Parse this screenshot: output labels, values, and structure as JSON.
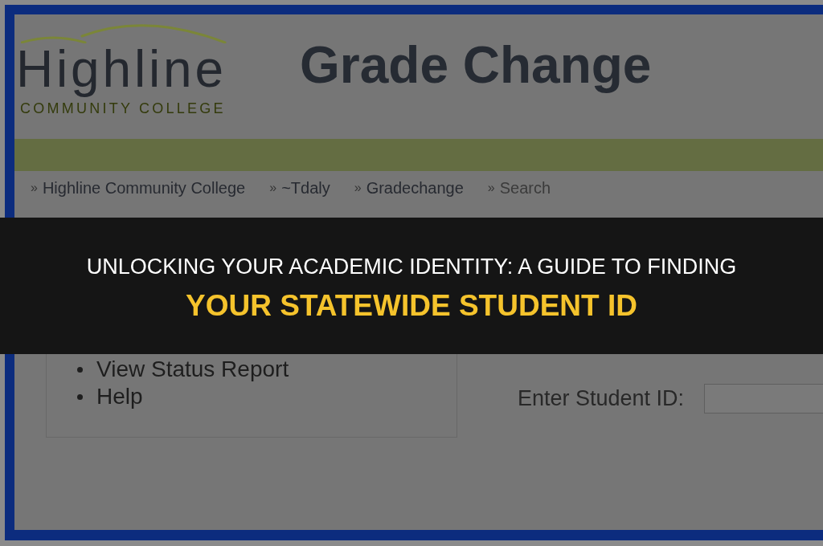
{
  "page": {
    "logo": {
      "name": "Highline",
      "tagline": "COMMUNITY COLLEGE"
    },
    "title": "Grade Change",
    "breadcrumbs": [
      {
        "marker": "»",
        "label": "Highline Community College",
        "current": false
      },
      {
        "marker": "»",
        "label": "~Tdaly",
        "current": false
      },
      {
        "marker": "»",
        "label": "Gradechange",
        "current": false
      },
      {
        "marker": "»",
        "label": "Search",
        "current": true
      }
    ],
    "quick_links": [
      {
        "label": "View Status Report"
      },
      {
        "label": "Help"
      }
    ],
    "student_id_field": {
      "label": "Enter Student ID:"
    }
  },
  "banner": {
    "headline": "UNLOCKING YOUR ACADEMIC IDENTITY: A GUIDE TO FINDING",
    "highlight": "YOUR STATEWIDE STUDENT ID"
  }
}
